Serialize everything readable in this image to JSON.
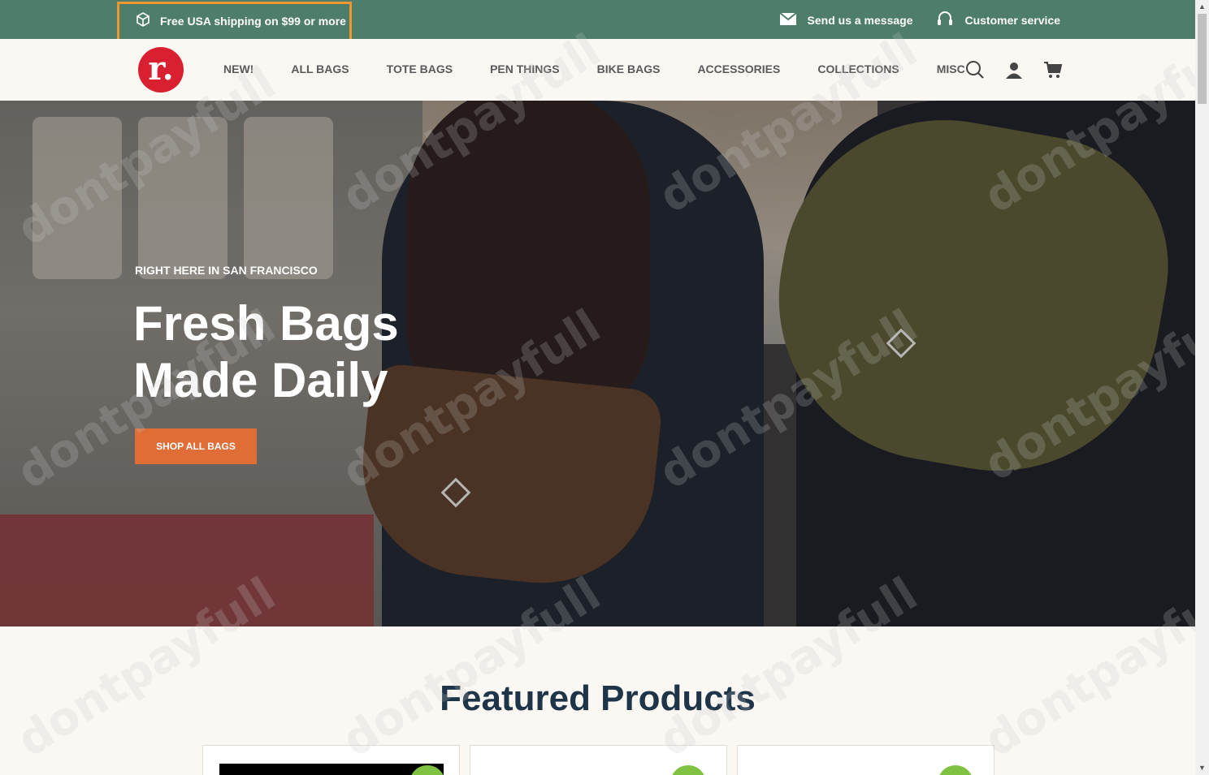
{
  "topbar": {
    "promo_text": "Free USA shipping on $99 or more",
    "message_link": "Send us a message",
    "service_link": "Customer service"
  },
  "logo": {
    "text": "r."
  },
  "nav": {
    "items": [
      {
        "label": "NEW!"
      },
      {
        "label": "ALL BAGS"
      },
      {
        "label": "TOTE BAGS"
      },
      {
        "label": "PEN THINGS"
      },
      {
        "label": "BIKE BAGS"
      },
      {
        "label": "ACCESSORIES"
      },
      {
        "label": "COLLECTIONS"
      },
      {
        "label": "MISC"
      }
    ],
    "icons": [
      "search-icon",
      "account-icon",
      "cart-icon"
    ]
  },
  "hero": {
    "eyebrow": "RIGHT HERE IN SAN FRANCISCO",
    "headline_line1": "Fresh Bags",
    "headline_line2": "Made Daily",
    "cta_label": "SHOP ALL BAGS"
  },
  "featured": {
    "title": "Featured Products"
  },
  "watermark": "dontpayfull",
  "colors": {
    "topbar": "#4e7e6a",
    "promo_highlight": "#ef9630",
    "logo": "#d92030",
    "cta": "#e06c36",
    "title": "#1e3448"
  }
}
